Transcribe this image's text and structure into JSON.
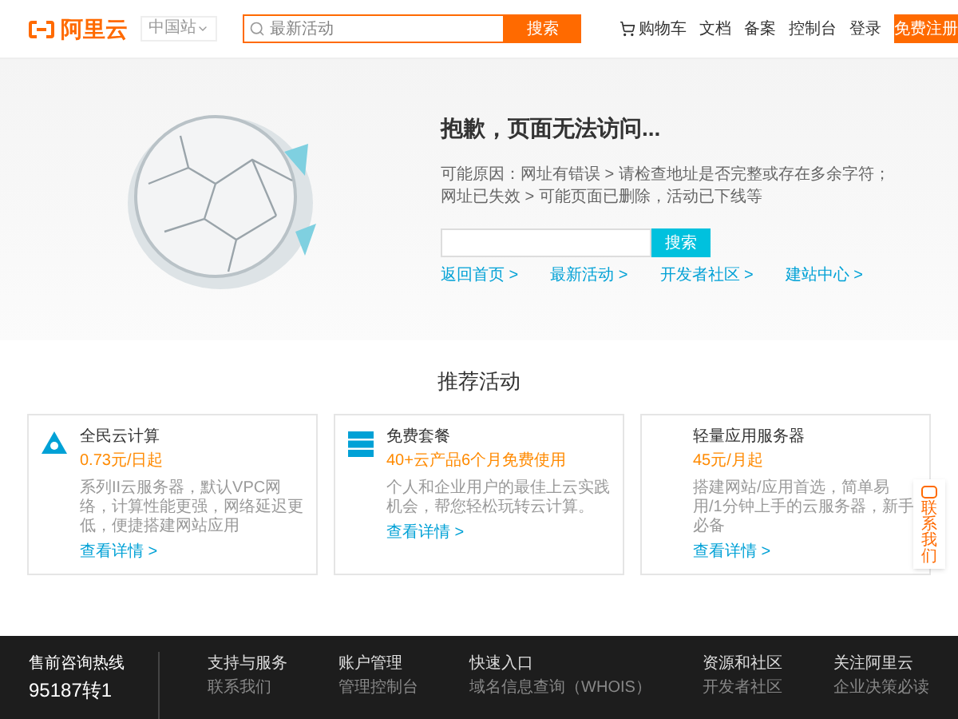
{
  "header": {
    "logo": "阿里云",
    "region": "中国站",
    "search": {
      "placeholder": "最新活动",
      "button": "搜索"
    },
    "nav": [
      {
        "kind": "cart",
        "label": "购物车"
      },
      {
        "kind": "link",
        "label": "文档"
      },
      {
        "kind": "link",
        "label": "备案"
      },
      {
        "kind": "link",
        "label": "控制台"
      },
      {
        "kind": "link",
        "label": "登录"
      }
    ],
    "register": "免费注册"
  },
  "error": {
    "title": "抱歉，页面无法访问...",
    "reasons": [
      "可能原因：网址有错误 > 请检查地址是否完整或存在多余字符；",
      "网址已失效 > 可能页面已删除，活动已下线等"
    ],
    "search_button": "搜索",
    "links": [
      "返回首页 >",
      "最新活动 >",
      "开发者社区 >",
      "建站中心 >"
    ]
  },
  "recommend": {
    "title": "推荐活动",
    "cards": [
      {
        "kind": "triangle",
        "title": "全民云计算",
        "price": "0.73元/日起",
        "desc": "系列II云服务器，默认VPC网络，计算性能更强，网络延迟更低，便捷搭建网站应用",
        "link": "查看详情 >"
      },
      {
        "kind": "server",
        "title": "免费套餐",
        "price": "40+云产品6个月免费使用",
        "desc": "个人和企业用户的最佳上云实践机会，帮您轻松玩转云计算。",
        "link": "查看详情 >"
      },
      {
        "kind": "none",
        "title": "轻量应用服务器",
        "price": "45元/月起",
        "desc": "搭建网站/应用首选，简单易用/1分钟上手的云服务器，新手必备",
        "link": "查看详情 >"
      }
    ]
  },
  "contact": "联系我们",
  "footer": {
    "hotline_title": "售前咨询热线",
    "hotline": "95187转1",
    "columns": [
      {
        "title": "支持与服务",
        "link": "联系我们"
      },
      {
        "title": "账户管理",
        "link": "管理控制台"
      },
      {
        "title": "快速入口",
        "link": "域名信息查询（WHOIS）"
      },
      {
        "title": "资源和社区",
        "link": "开发者社区"
      },
      {
        "title": "关注阿里云",
        "link": "企业决策必读"
      }
    ]
  }
}
